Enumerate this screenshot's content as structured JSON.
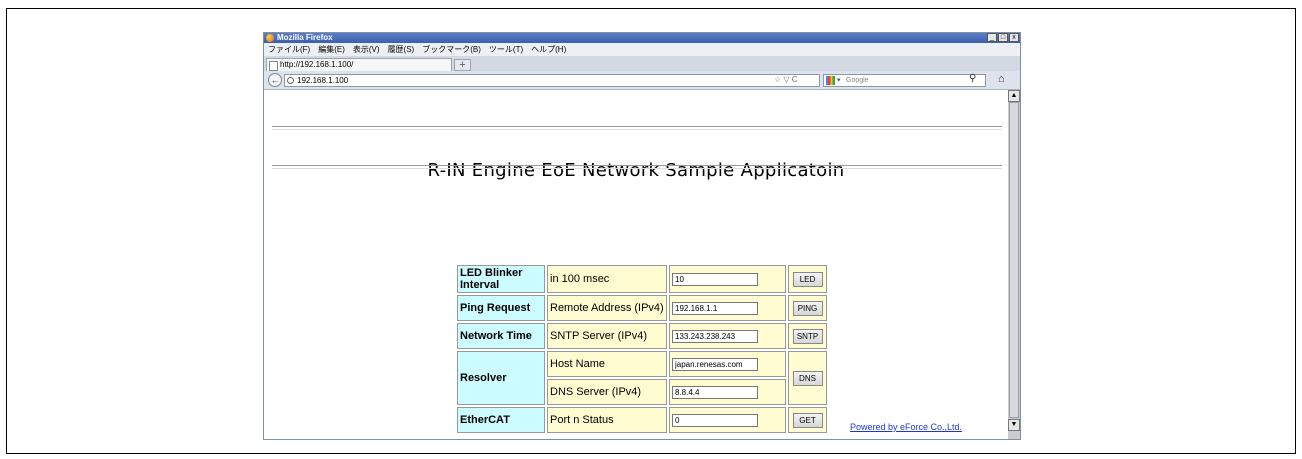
{
  "window": {
    "title": "Mozilla Firefox",
    "controls": [
      "_",
      "□",
      "x"
    ],
    "menu": [
      "ファイル(F)",
      "編集(E)",
      "表示(V)",
      "履歴(S)",
      "ブックマーク(B)",
      "ツール(T)",
      "ヘルプ(H)"
    ],
    "tab_title": "http://192.168.1.100/",
    "new_tab": "+"
  },
  "nav": {
    "back": "←",
    "url": "192.168.1.100",
    "url_icons": "☆ ▽ C",
    "search_placeholder": "Google",
    "search_icon": "magnifier-icon",
    "home": "⌂"
  },
  "page": {
    "title": "R-IN Engine EoE Network Sample Applicatoin",
    "rows": {
      "led": {
        "label": "LED Blinker Interval",
        "desc": "in 100 msec",
        "value": "10",
        "button": "LED"
      },
      "ping": {
        "label": "Ping Request",
        "desc": "Remote Address (IPv4)",
        "value": "192.168.1.1",
        "button": "PING"
      },
      "time": {
        "label": "Network Time",
        "desc": "SNTP Server (IPv4)",
        "value": "133.243.238.243",
        "button": "SNTP"
      },
      "resolver": {
        "label": "Resolver",
        "desc_host": "Host Name",
        "value_host": "japan.renesas.com",
        "desc_dns": "DNS Server (IPv4)",
        "value_dns": "8.8.4.4",
        "button": "DNS"
      },
      "ethercat": {
        "label": "EtherCAT",
        "desc": "Port n Status",
        "value": "0",
        "button": "GET"
      }
    },
    "footer": "Powered by eForce Co.,Ltd."
  },
  "colors": {
    "label_bg": "#ccfcff",
    "cell_bg": "#fffcd2",
    "link": "#1a37d6"
  }
}
